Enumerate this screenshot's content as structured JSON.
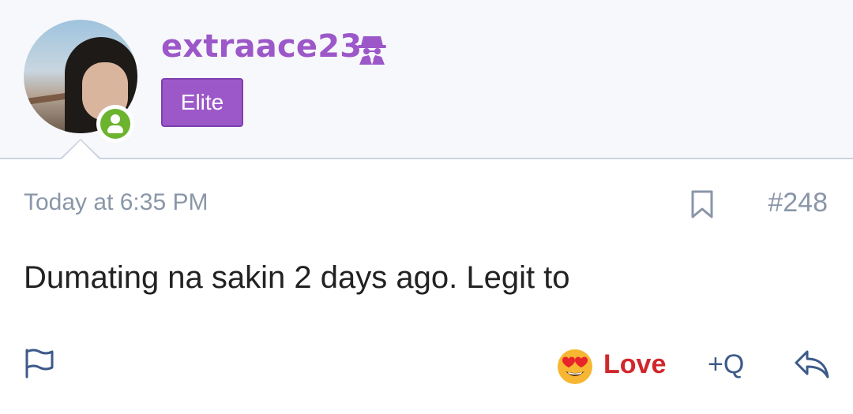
{
  "user": {
    "username": "extraace23",
    "badge": "Elite",
    "online_status": "online",
    "username_icon": "spy-icon"
  },
  "post": {
    "timestamp": "Today at 6:35 PM",
    "number": "#248",
    "message": "Dumating na sakin 2 days ago. Legit to"
  },
  "actions": {
    "reaction_label": "Love",
    "reaction_emoji": "heart-eyes-emoji",
    "quote_label": "+Q",
    "flag_icon": "flag-icon",
    "bookmark_icon": "bookmark-icon",
    "reply_icon": "reply-icon"
  },
  "colors": {
    "username": "#9c58c9",
    "badge_bg": "#9c58c9",
    "online": "#6cb32e",
    "love": "#d1262b",
    "muted": "#8a96a8",
    "icon": "#3d5a8a"
  }
}
